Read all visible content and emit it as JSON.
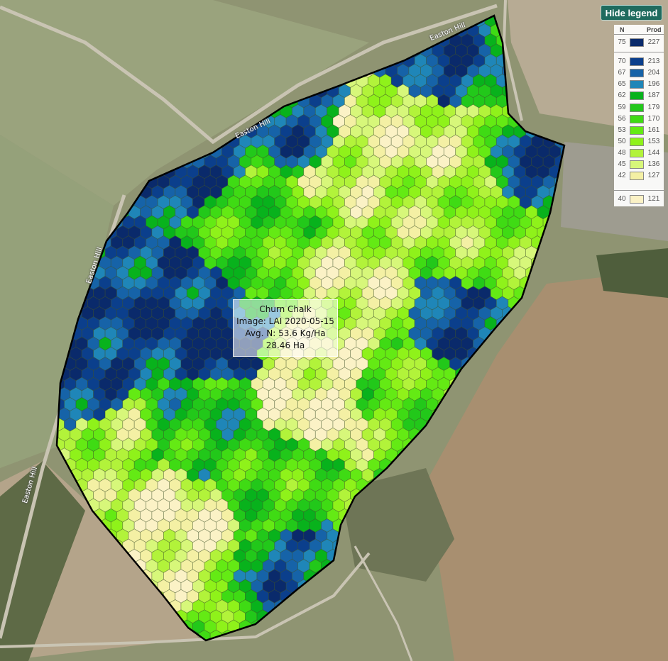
{
  "map": {
    "road_labels": [
      "Easton Hill",
      "Easton Hill",
      "Easton Hill",
      "Easton Hill"
    ]
  },
  "hide_legend_label": "Hide legend",
  "legend": {
    "header_n": "N",
    "header_prod": "Prod",
    "rows": [
      {
        "n": "75",
        "prod": "227",
        "color": "#0a2a6b"
      },
      {
        "n": "70",
        "prod": "213",
        "color": "#0b3f8c"
      },
      {
        "n": "67",
        "prod": "204",
        "color": "#1663a8"
      },
      {
        "n": "65",
        "prod": "196",
        "color": "#1f86b8"
      },
      {
        "n": "62",
        "prod": "187",
        "color": "#08b21c"
      },
      {
        "n": "59",
        "prod": "179",
        "color": "#22c81a"
      },
      {
        "n": "56",
        "prod": "170",
        "color": "#3fdb14"
      },
      {
        "n": "53",
        "prod": "161",
        "color": "#64ea14"
      },
      {
        "n": "50",
        "prod": "153",
        "color": "#8ff21a"
      },
      {
        "n": "48",
        "prod": "144",
        "color": "#b2f33a"
      },
      {
        "n": "45",
        "prod": "136",
        "color": "#d7f77a"
      },
      {
        "n": "42",
        "prod": "127",
        "color": "#f4f0a4"
      },
      {
        "n": "40",
        "prod": "121",
        "color": "#fbf2c6"
      }
    ]
  },
  "field_info": {
    "name": "Churn Chalk",
    "image": "Image: LAI 2020-05-15",
    "avg_n": "Avg. N: 53.6 Kg/Ha",
    "area": "28.46 Ha"
  }
}
